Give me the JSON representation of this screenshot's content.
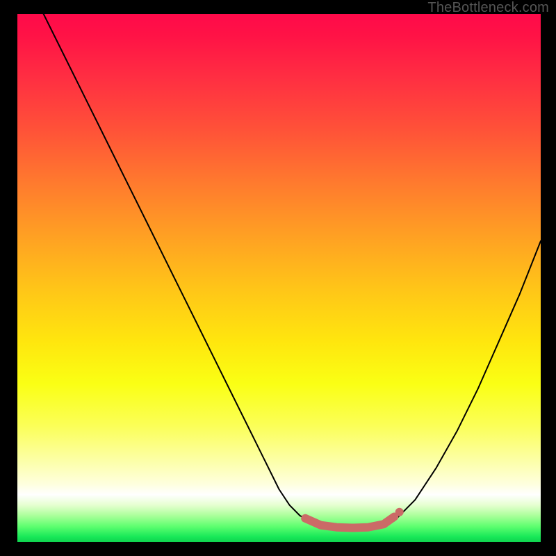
{
  "watermark": {
    "text": "TheBottleneck.com"
  },
  "colors": {
    "plateau_stroke": "#cb6a67",
    "curve_stroke": "#000000",
    "frame_bg": "#000000"
  },
  "chart_data": {
    "type": "line",
    "title": "",
    "xlabel": "",
    "ylabel": "",
    "xlim": [
      0,
      100
    ],
    "ylim": [
      0,
      100
    ],
    "grid": false,
    "legend": false,
    "note": "Bottleneck-style V-curve over rainbow gradient. Y is plotted inverted (0 at top, 100 at bottom). Values estimated from pixel positions; no axis labels are rendered.",
    "series": [
      {
        "name": "left_curve",
        "x": [
          5,
          10,
          15,
          20,
          25,
          30,
          35,
          40,
          45,
          50,
          52,
          54,
          56
        ],
        "y": [
          0,
          10,
          20,
          30,
          40,
          50,
          60,
          70,
          80,
          90,
          93,
          95,
          96
        ]
      },
      {
        "name": "right_curve",
        "x": [
          72,
          74,
          76,
          78,
          80,
          84,
          88,
          92,
          96,
          100
        ],
        "y": [
          96,
          94,
          92,
          89,
          86,
          79,
          71,
          62,
          53,
          43
        ]
      },
      {
        "name": "plateau_highlight",
        "x": [
          55,
          58,
          61,
          64,
          67,
          70,
          72
        ],
        "y": [
          95.5,
          96.8,
          97.2,
          97.3,
          97.2,
          96.6,
          95.2
        ]
      }
    ],
    "markers": [
      {
        "name": "plateau_end_dot",
        "x": 73,
        "y": 94.3
      }
    ]
  }
}
